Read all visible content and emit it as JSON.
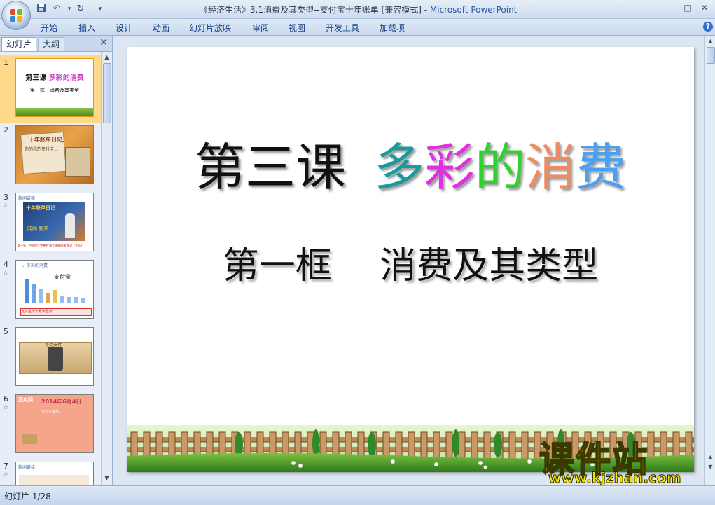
{
  "window": {
    "title_doc": "《经济生活》3.1消费及其类型--支付宝十年账单 [兼容模式] - ",
    "title_app": "Microsoft PowerPoint",
    "controls": [
      "–",
      "□",
      "✕"
    ]
  },
  "ribbon": {
    "tabs": [
      "开始",
      "插入",
      "设计",
      "动画",
      "幻灯片放映",
      "审阅",
      "视图",
      "开发工具",
      "加载项"
    ],
    "help": "?"
  },
  "left_pane": {
    "tabs": [
      "幻灯片",
      "大纲"
    ],
    "close": "✕",
    "slides": [
      {
        "num": "1",
        "star": "",
        "title": "第三课",
        "title_color": "多彩的消费",
        "subtitle": "第一框　消费及其类型"
      },
      {
        "num": "2",
        "star": "",
        "label": "「十年账单日记」",
        "sub": "你的我的支付宝…"
      },
      {
        "num": "3",
        "star": "☆",
        "header": "新闻链接",
        "label": "十年账单日记",
        "caption": "网购 繁荣",
        "footer": "第一条：中国首个完整的'最大规模账单'发现了什么？"
      },
      {
        "num": "4",
        "star": "☆",
        "header": "一、多彩的消费",
        "label": "支付宝",
        "footer": "支付宝十年账单显示"
      },
      {
        "num": "5",
        "star": "",
        "label": "移动支付"
      },
      {
        "num": "6",
        "star": "☆",
        "header": "西瓜网",
        "label": "2014年6月4日",
        "caption": "支付宝发布…"
      },
      {
        "num": "7",
        "star": "☆",
        "header": "新闻链接"
      }
    ]
  },
  "slide": {
    "title_black": "第三课",
    "title_colored": [
      "多",
      "彩",
      "的",
      "消",
      "费"
    ],
    "subtitle": "第一框　 消费及其类型"
  },
  "watermark": {
    "cn": "课件站",
    "url": "www.kjzhan.com"
  },
  "status": {
    "text": "幻灯片 1/28"
  },
  "colors": {
    "title_teal": "#1a9a9a",
    "title_magenta": "#e030e0",
    "title_green": "#30d030",
    "title_salmon": "#f08a60",
    "title_blue": "#4aa0f0",
    "selected_slide": "#ffd98a"
  }
}
